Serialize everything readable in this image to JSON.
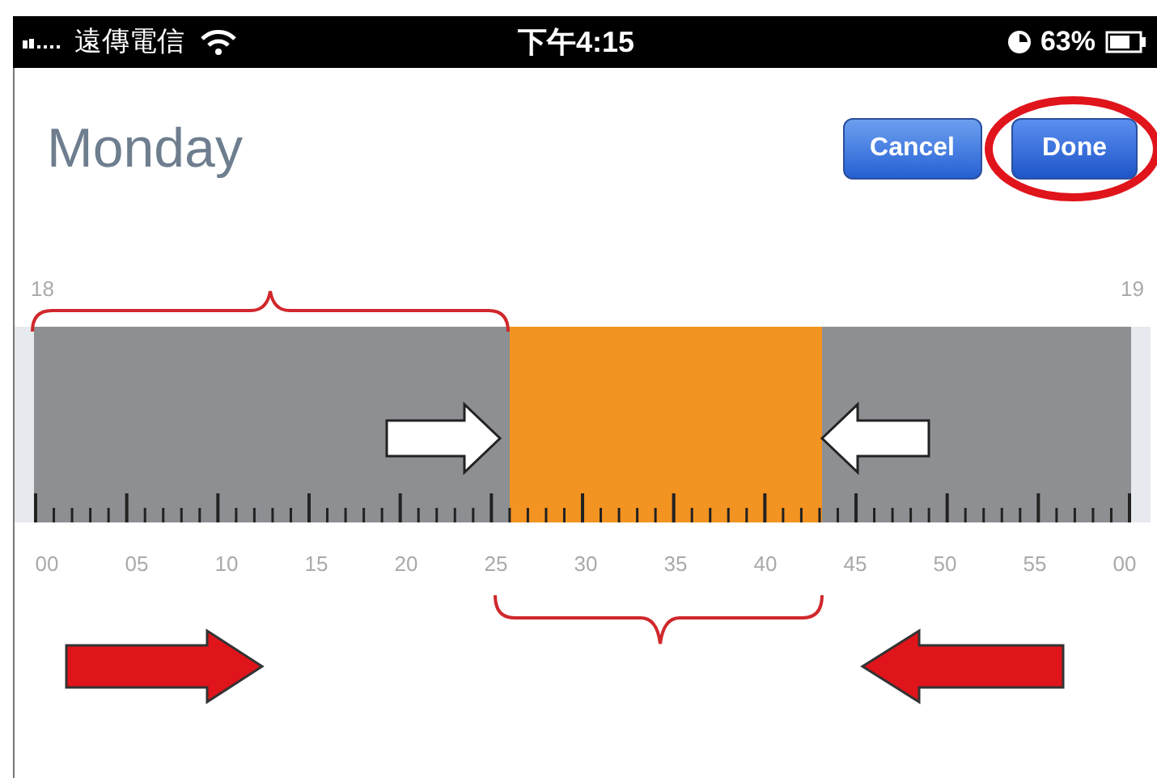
{
  "status_bar": {
    "carrier": "遠傳電信",
    "time": "下午4:15",
    "battery": "63%"
  },
  "title": "Monday",
  "buttons": [
    {
      "label": "Cancel",
      "kind": "cancel"
    },
    {
      "label": "Done",
      "kind": "done"
    }
  ],
  "timeline": {
    "start_hour": "18",
    "end_hour": "19",
    "minute_labels": [
      "00",
      "05",
      "10",
      "15",
      "20",
      "25",
      "30",
      "35",
      "40",
      "45",
      "50",
      "55",
      "00"
    ]
  }
}
